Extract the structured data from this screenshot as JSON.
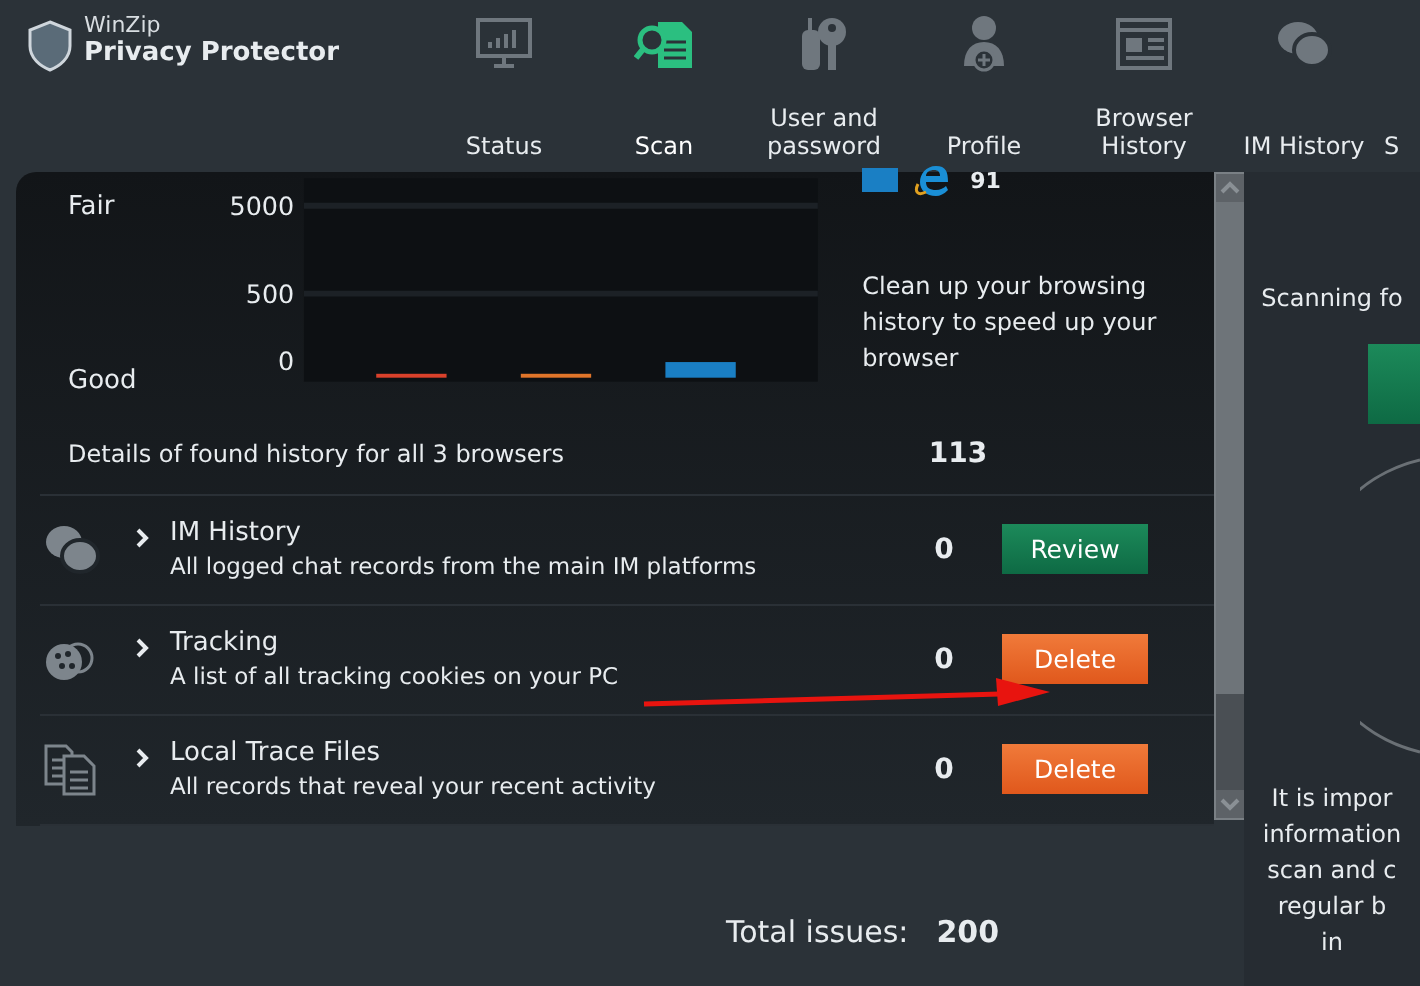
{
  "app": {
    "brand": "WinZip",
    "title": "Privacy Protector"
  },
  "nav": [
    {
      "label": "Status",
      "kind": "status",
      "selected": false
    },
    {
      "label": "Scan",
      "kind": "scan",
      "selected": true
    },
    {
      "label": "User and password",
      "kind": "keys",
      "selected": false
    },
    {
      "label": "Profile",
      "kind": "profile",
      "selected": false
    },
    {
      "label": "Browser History",
      "kind": "browser",
      "selected": false
    },
    {
      "label": "IM History",
      "kind": "chat",
      "selected": false
    },
    {
      "label": "S",
      "kind": "none",
      "selected": false
    }
  ],
  "chart": {
    "levels": [
      "Fair",
      "Good"
    ],
    "legend_value": "91",
    "description": "Clean up your browsing history to speed up your browser",
    "scale_labels": [
      "5000",
      "500",
      "0"
    ]
  },
  "browser_summary": {
    "label": "Details of found history for all 3 browsers",
    "count": "113"
  },
  "rows": [
    {
      "kind": "chat",
      "title": "IM History",
      "description": "All logged chat records from the main IM platforms",
      "count": "0",
      "expanded": false,
      "button": {
        "label": "Review",
        "kind": "review"
      }
    },
    {
      "kind": "cookie",
      "title": "Tracking",
      "description": "A list of all tracking cookies on your PC",
      "count": "0",
      "expanded": false,
      "button": {
        "label": "Delete",
        "kind": "delete"
      }
    },
    {
      "kind": "files",
      "title": "Local Trace Files",
      "description": "All records that reveal your recent activity",
      "count": "0",
      "expanded": false,
      "button": {
        "label": "Delete",
        "kind": "delete"
      }
    }
  ],
  "total": {
    "label": "Total issues:",
    "value": "200"
  },
  "side": {
    "heading": "Scanning fo",
    "lines": [
      "It is impor",
      "information",
      "scan and c",
      "regular b",
      "in"
    ]
  }
}
